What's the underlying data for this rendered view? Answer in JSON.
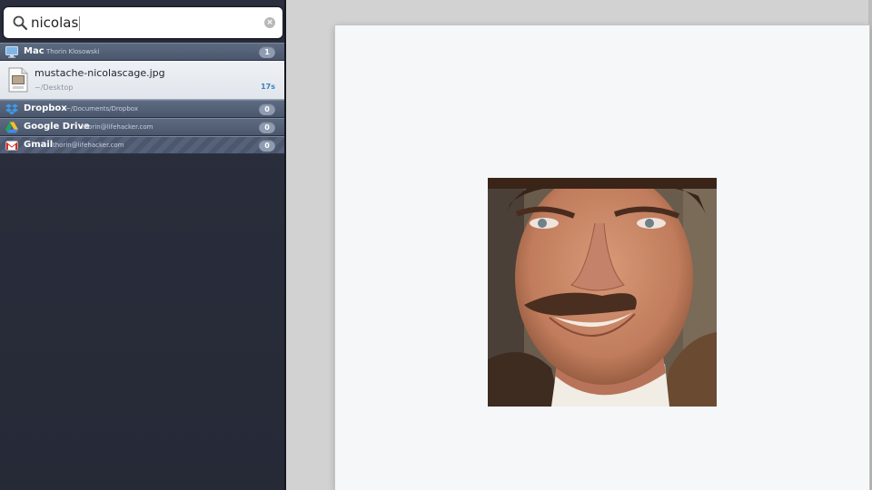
{
  "search": {
    "query": "nicolas"
  },
  "groups": [
    {
      "name": "Mac",
      "sub": "Thorin Klosowski",
      "count": "1"
    },
    {
      "name": "Dropbox",
      "sub": "~/Documents/Dropbox",
      "count": "0"
    },
    {
      "name": "Google Drive",
      "sub": "thorin@lifehacker.com",
      "count": "0"
    },
    {
      "name": "Gmail",
      "sub": "thorin@lifehacker.com",
      "count": "0"
    }
  ],
  "result": {
    "file_name": "mustache-nicolascage.jpg",
    "path": "~/Desktop",
    "age": "17s"
  },
  "colors": {
    "panel_bg": "#2b2f3d",
    "group_header": "#5d6b82",
    "accent": "#3a7fc0"
  },
  "icons": {
    "search": "magnifier-icon",
    "clear": "clear-circle-icon",
    "mac": "monitor-icon",
    "dropbox": "dropbox-icon",
    "google_drive": "google-drive-icon",
    "gmail": "gmail-icon",
    "file": "jpg-file-icon"
  }
}
